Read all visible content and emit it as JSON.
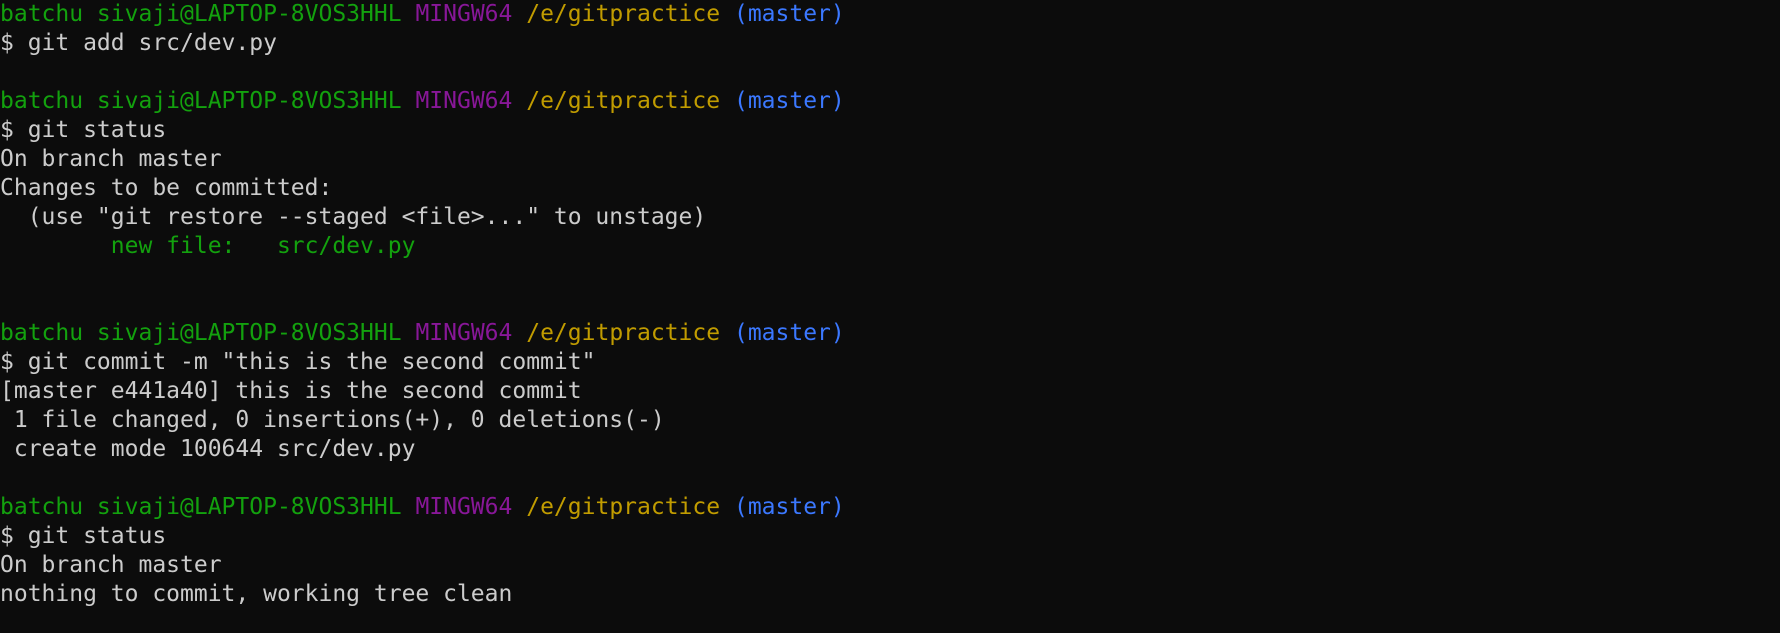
{
  "colors": {
    "background": "#0c0c0c",
    "default_text": "#cccccc",
    "user_host": "#13a10e",
    "env": "#881798",
    "path": "#c19c00",
    "branch": "#3b78ff",
    "staged_file": "#13a10e"
  },
  "lines": [
    {
      "type": "prompt",
      "user_host": "batchu sivaji@LAPTOP-8VOS3HHL",
      "env": "MINGW64",
      "path": "/e/gitpractice",
      "branch": "(master)"
    },
    {
      "type": "command",
      "text": "$ git add src/dev.py"
    },
    {
      "type": "blank",
      "text": ""
    },
    {
      "type": "prompt",
      "user_host": "batchu sivaji@LAPTOP-8VOS3HHL",
      "env": "MINGW64",
      "path": "/e/gitpractice",
      "branch": "(master)"
    },
    {
      "type": "command",
      "text": "$ git status"
    },
    {
      "type": "output",
      "text": "On branch master"
    },
    {
      "type": "output",
      "text": "Changes to be committed:"
    },
    {
      "type": "output",
      "text": "  (use \"git restore --staged <file>...\" to unstage)"
    },
    {
      "type": "staged",
      "text": "        new file:   src/dev.py"
    },
    {
      "type": "blank",
      "text": ""
    },
    {
      "type": "blank",
      "text": ""
    },
    {
      "type": "prompt",
      "user_host": "batchu sivaji@LAPTOP-8VOS3HHL",
      "env": "MINGW64",
      "path": "/e/gitpractice",
      "branch": "(master)"
    },
    {
      "type": "command",
      "text": "$ git commit -m \"this is the second commit\""
    },
    {
      "type": "output",
      "text": "[master e441a40] this is the second commit"
    },
    {
      "type": "output",
      "text": " 1 file changed, 0 insertions(+), 0 deletions(-)"
    },
    {
      "type": "output",
      "text": " create mode 100644 src/dev.py"
    },
    {
      "type": "blank",
      "text": ""
    },
    {
      "type": "prompt",
      "user_host": "batchu sivaji@LAPTOP-8VOS3HHL",
      "env": "MINGW64",
      "path": "/e/gitpractice",
      "branch": "(master)"
    },
    {
      "type": "command",
      "text": "$ git status"
    },
    {
      "type": "output",
      "text": "On branch master"
    },
    {
      "type": "output",
      "text": "nothing to commit, working tree clean"
    }
  ]
}
